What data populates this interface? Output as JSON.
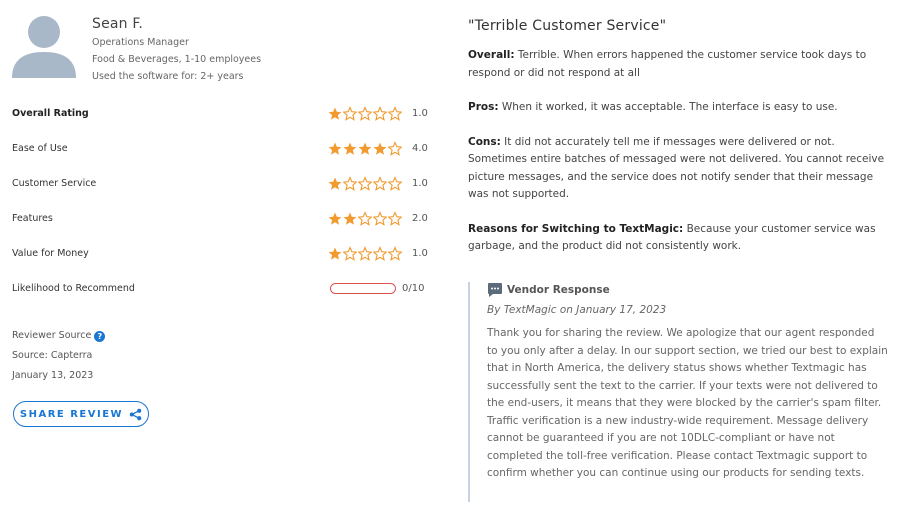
{
  "reviewer": {
    "name": "Sean F.",
    "role": "Operations Manager",
    "company": "Food & Beverages, 1-10 employees",
    "usage": "Used the software for: 2+ years"
  },
  "ratings": [
    {
      "label": "Overall Rating",
      "score": "1.0",
      "stars": 1
    },
    {
      "label": "Ease of Use",
      "score": "4.0",
      "stars": 4
    },
    {
      "label": "Customer Service",
      "score": "1.0",
      "stars": 1
    },
    {
      "label": "Features",
      "score": "2.0",
      "stars": 2
    },
    {
      "label": "Value for Money",
      "score": "1.0",
      "stars": 1
    }
  ],
  "recommend": {
    "label": "Likelihood to Recommend",
    "score": "0/10",
    "fraction": 0
  },
  "source": {
    "reviewer_source_label": "Reviewer Source",
    "source_text": "Source: Capterra",
    "date": "January 13, 2023"
  },
  "share_label": "SHARE REVIEW",
  "review": {
    "title": "\"Terrible Customer Service\"",
    "overall_label": "Overall:",
    "overall_text": " Terrible. When errors happened the customer service took days to respond or did not respond at all",
    "pros_label": "Pros:",
    "pros_text": " When it worked, it was acceptable. The interface is easy to use.",
    "cons_label": "Cons:",
    "cons_text": " It did not accurately tell me if messages were delivered or not. Sometimes entire batches of messaged were not delivered. You cannot receive picture messages, and the service does not notify sender that their message was not supported.",
    "switch_label": "Reasons for Switching to TextMagic:",
    "switch_text": " Because your customer service was garbage, and the product did not consistently work."
  },
  "vendor": {
    "heading": "Vendor Response",
    "by": "By TextMagic on January 17, 2023",
    "text": "Thank you for sharing the review. We apologize that our agent responded to you only after a delay. In our support section, we tried our best to explain that in North America, the delivery status shows whether Textmagic has successfully sent the text to the carrier. If your texts were not delivered to the end-users, it means that they were blocked by the carrier's spam filter. Traffic verification is a new industry-wide requirement. Message delivery cannot be guaranteed if you are not 10DLC-compliant or have not completed the toll-free verification. Please contact Textmagic support to confirm whether you can continue using our products for sending texts."
  },
  "colors": {
    "star": "#f29a2e",
    "accent": "#1976d2",
    "recommend_bar": "#d9534f"
  }
}
